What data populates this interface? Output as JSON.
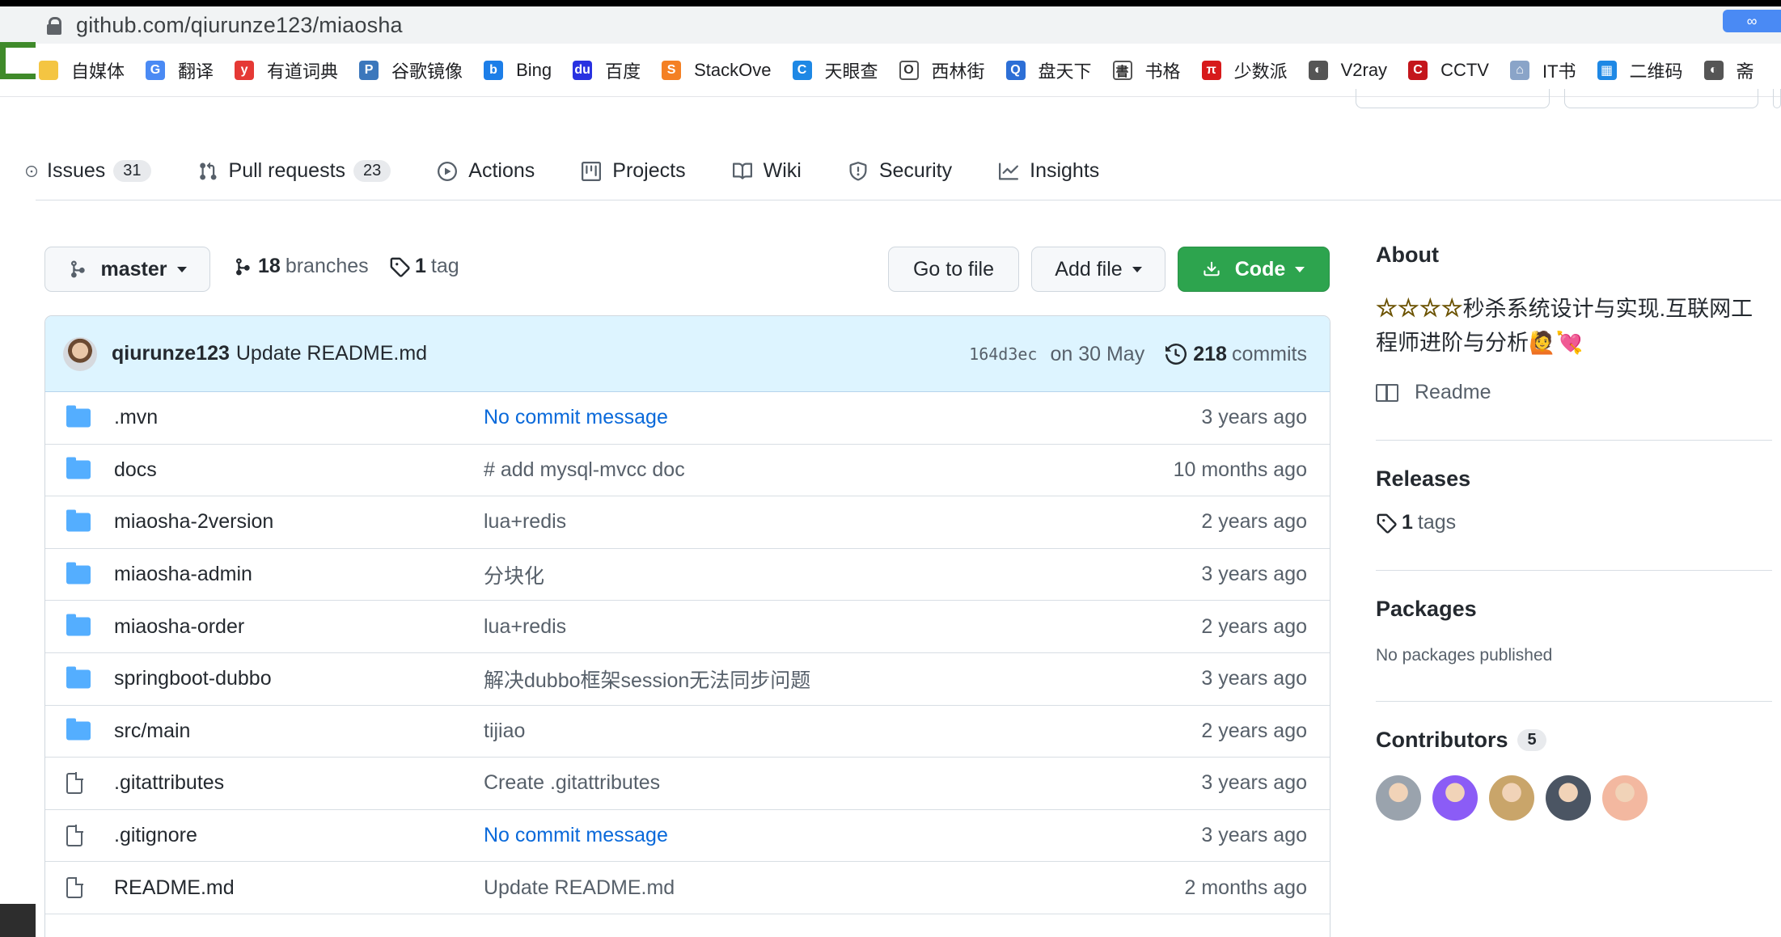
{
  "browser": {
    "url": "github.com/qiurunze123/miaosha",
    "bookmarks": [
      {
        "label": "自媒体",
        "color": "#f4c542",
        "glyph": ""
      },
      {
        "label": "翻译",
        "color": "#4a8af4",
        "glyph": "G"
      },
      {
        "label": "有道词典",
        "color": "#e53935",
        "glyph": "y"
      },
      {
        "label": "谷歌镜像",
        "color": "#3b77bc",
        "glyph": "P"
      },
      {
        "label": "Bing",
        "color": "#1c7ee8",
        "glyph": "b"
      },
      {
        "label": "百度",
        "color": "#2932e1",
        "glyph": "du"
      },
      {
        "label": "StackOve",
        "color": "#f48024",
        "glyph": "S"
      },
      {
        "label": "天眼查",
        "color": "#1e88e5",
        "glyph": "C"
      },
      {
        "label": "西林街",
        "color": "#ffffff",
        "glyph": "O"
      },
      {
        "label": "盘天下",
        "color": "#2d6fd6",
        "glyph": "Q"
      },
      {
        "label": "书格",
        "color": "#ffffff",
        "glyph": "書"
      },
      {
        "label": "少数派",
        "color": "#d71a1b",
        "glyph": "π"
      },
      {
        "label": "V2ray",
        "color": "#555555",
        "glyph": "◐"
      },
      {
        "label": "CCTV",
        "color": "#c4161c",
        "glyph": "C"
      },
      {
        "label": "IT书",
        "color": "#8aa4c8",
        "glyph": "⌂"
      },
      {
        "label": "二维码",
        "color": "#1e88e5",
        "glyph": "▦"
      },
      {
        "label": "斋",
        "color": "#555555",
        "glyph": "◐"
      }
    ]
  },
  "nav": {
    "tabs": [
      {
        "label": "Issues",
        "count": "31",
        "icon": "issue-icon"
      },
      {
        "label": "Pull requests",
        "count": "23",
        "icon": "pull-request-icon"
      },
      {
        "label": "Actions",
        "count": null,
        "icon": "play-icon"
      },
      {
        "label": "Projects",
        "count": null,
        "icon": "project-icon"
      },
      {
        "label": "Wiki",
        "count": null,
        "icon": "book-icon"
      },
      {
        "label": "Security",
        "count": null,
        "icon": "shield-icon"
      },
      {
        "label": "Insights",
        "count": null,
        "icon": "graph-icon"
      }
    ]
  },
  "toolbar": {
    "branch": "master",
    "branches_count": "18",
    "branches_label": "branches",
    "tags_count": "1",
    "tags_label": "tag",
    "goto_file": "Go to file",
    "add_file": "Add file",
    "code": "Code"
  },
  "commit": {
    "author": "qiurunze123",
    "message": "Update README.md",
    "sha": "164d3ec",
    "date": "on 30 May",
    "commits_count": "218",
    "commits_label": "commits"
  },
  "files": [
    {
      "type": "dir",
      "name": ".mvn",
      "message": "No commit message",
      "link": true,
      "age": "3 years ago"
    },
    {
      "type": "dir",
      "name": "docs",
      "message": "# add mysql-mvcc doc",
      "link": false,
      "age": "10 months ago"
    },
    {
      "type": "dir",
      "name": "miaosha-2version",
      "message": "lua+redis",
      "link": false,
      "age": "2 years ago"
    },
    {
      "type": "dir",
      "name": "miaosha-admin",
      "message": "分块化",
      "link": false,
      "age": "3 years ago"
    },
    {
      "type": "dir",
      "name": "miaosha-order",
      "message": "lua+redis",
      "link": false,
      "age": "2 years ago"
    },
    {
      "type": "dir",
      "name": "springboot-dubbo",
      "message": "解决dubbo框架session无法同步问题",
      "link": false,
      "age": "3 years ago"
    },
    {
      "type": "dir",
      "name": "src/main",
      "message": "tijiao",
      "link": false,
      "age": "2 years ago"
    },
    {
      "type": "file",
      "name": ".gitattributes",
      "message": "Create .gitattributes",
      "link": false,
      "age": "3 years ago"
    },
    {
      "type": "file",
      "name": ".gitignore",
      "message": "No commit message",
      "link": true,
      "age": "3 years ago"
    },
    {
      "type": "file",
      "name": "README.md",
      "message": "Update README.md",
      "link": false,
      "age": "2 months ago"
    }
  ],
  "sidebar": {
    "about_title": "About",
    "about_desc": "秒杀系统设计与实现.互联网工程师进阶与分析",
    "readme": "Readme",
    "releases_title": "Releases",
    "tags_count": "1",
    "tags_label": "tags",
    "packages_title": "Packages",
    "packages_empty": "No packages published",
    "contributors_title": "Contributors",
    "contributors_count": "5",
    "avatar_colors": [
      "#9aa3ad",
      "#8b5cf6",
      "#c9a56a",
      "#4b5563",
      "#f3b8a0"
    ]
  },
  "colors": {
    "accent": "#0969da",
    "code_button": "#2da44e",
    "commit_bar": "#ddf4ff",
    "folder": "#54aeff"
  }
}
